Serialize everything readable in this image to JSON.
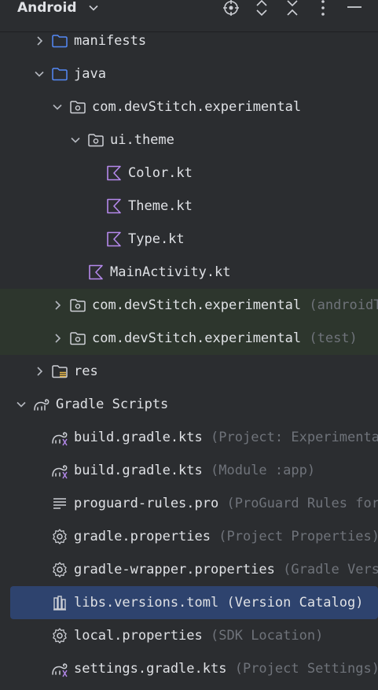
{
  "toolbar": {
    "title": "Android",
    "icons": [
      "chevron-down-icon",
      "locate-icon",
      "expand-all-icon",
      "collapse-all-icon",
      "more-options-icon",
      "hide-icon"
    ]
  },
  "tree": [
    {
      "name": "tree-row-manifests",
      "label": "manifests",
      "hint": "",
      "icon": "folder-icon"
    },
    {
      "name": "tree-row-java",
      "label": "java",
      "hint": "",
      "icon": "folder-icon"
    },
    {
      "name": "tree-row-package-main",
      "label": "com.devStitch.experimental",
      "hint": "",
      "icon": "package-icon"
    },
    {
      "name": "tree-row-ui-theme",
      "label": "ui.theme",
      "hint": "",
      "icon": "package-icon"
    },
    {
      "name": "tree-row-color-kt",
      "label": "Color.kt",
      "hint": "",
      "icon": "kotlin-file-icon"
    },
    {
      "name": "tree-row-theme-kt",
      "label": "Theme.kt",
      "hint": "",
      "icon": "kotlin-file-icon"
    },
    {
      "name": "tree-row-type-kt",
      "label": "Type.kt",
      "hint": "",
      "icon": "kotlin-file-icon"
    },
    {
      "name": "tree-row-mainactivity-kt",
      "label": "MainActivity.kt",
      "hint": "",
      "icon": "kotlin-file-icon"
    },
    {
      "name": "tree-row-package-androidtest",
      "label": "com.devStitch.experimental",
      "hint": "(androidTest)",
      "icon": "package-icon"
    },
    {
      "name": "tree-row-package-test",
      "label": "com.devStitch.experimental",
      "hint": "(test)",
      "icon": "package-icon"
    },
    {
      "name": "tree-row-res",
      "label": "res",
      "hint": "",
      "icon": "resources-folder-icon"
    },
    {
      "name": "tree-row-gradle-scripts",
      "label": "Gradle Scripts",
      "hint": "",
      "icon": "gradle-icon"
    },
    {
      "name": "tree-row-build-gradle-project",
      "label": "build.gradle.kts",
      "hint": "(Project: Experimental)",
      "icon": "gradle-file-icon"
    },
    {
      "name": "tree-row-build-gradle-module",
      "label": "build.gradle.kts",
      "hint": "(Module :app)",
      "icon": "gradle-file-icon"
    },
    {
      "name": "tree-row-proguard",
      "label": "proguard-rules.pro",
      "hint": "(ProGuard Rules for \":app\")",
      "icon": "text-file-icon"
    },
    {
      "name": "tree-row-gradle-properties",
      "label": "gradle.properties",
      "hint": "(Project Properties)",
      "icon": "settings-file-icon"
    },
    {
      "name": "tree-row-gradle-wrapper-properties",
      "label": "gradle-wrapper.properties",
      "hint": "(Gradle Version)",
      "icon": "settings-file-icon"
    },
    {
      "name": "tree-row-libs-versions-toml",
      "label": "libs.versions.toml",
      "hint": "(Version Catalog)",
      "icon": "version-catalog-icon"
    },
    {
      "name": "tree-row-local-properties",
      "label": "local.properties",
      "hint": "(SDK Location)",
      "icon": "settings-file-icon"
    },
    {
      "name": "tree-row-settings-gradle",
      "label": "settings.gradle.kts",
      "hint": "(Project Settings)",
      "icon": "gradle-file-icon"
    }
  ],
  "colors": {
    "background": "#2b2d30",
    "selection": "#2e436e",
    "test_background": "#2d362d",
    "text": "#dfe1e5",
    "hint": "#6f737a",
    "folder": "#548af7",
    "kotlin": "#b589ec"
  }
}
